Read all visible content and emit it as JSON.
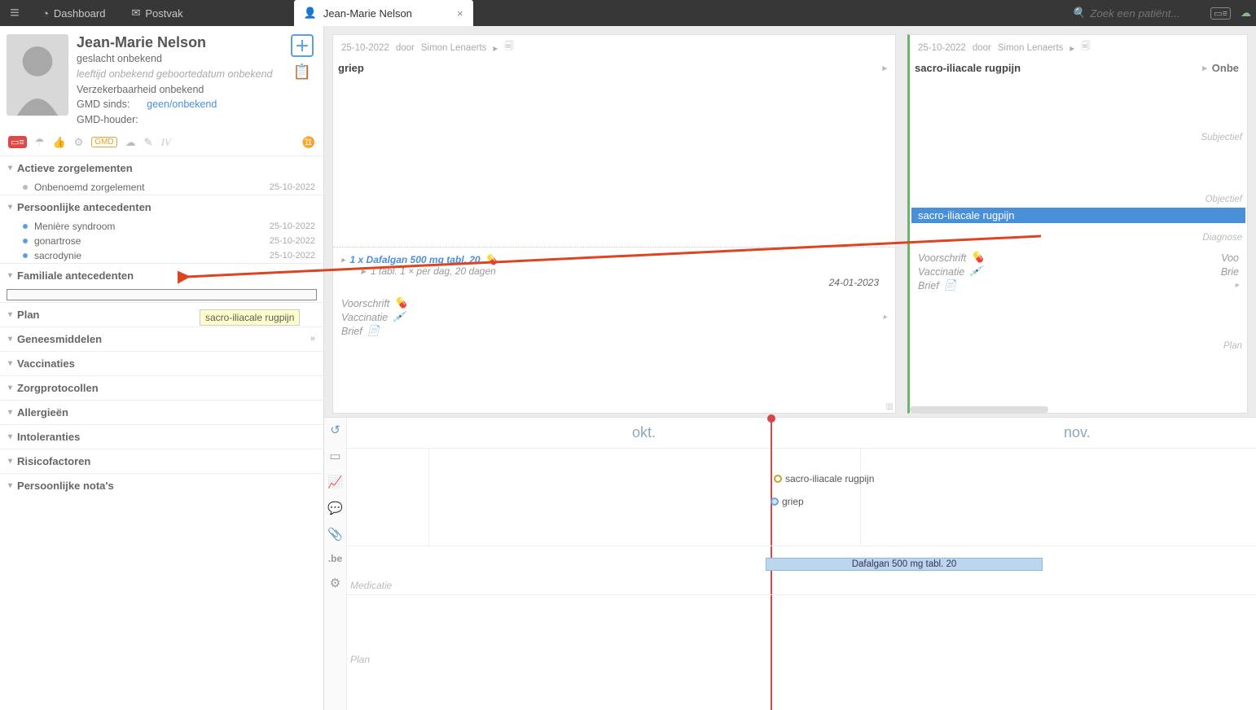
{
  "topbar": {
    "dashboard": "Dashboard",
    "postvak": "Postvak",
    "tab_label": "Jean-Marie Nelson",
    "search_placeholder": "Zoek een patiënt..."
  },
  "patient": {
    "name": "Jean-Marie Nelson",
    "gender": "geslacht onbekend",
    "age_birth": "leeftijd onbekend geboortedatum onbekend",
    "insurability": "Verzekerbaarheid onbekend",
    "gmd_since_label": "GMD sinds:",
    "gmd_since_value": "geen/onbekend",
    "gmd_holder_label": "GMD-houder:"
  },
  "iconrow": {
    "gmd_badge": "GMD",
    "iv": "IV"
  },
  "sections": {
    "actieve": {
      "title": "Actieve zorgelementen",
      "items": [
        {
          "label": "Onbenoemd zorgelement",
          "date": "25-10-2022",
          "dot": "grey"
        }
      ]
    },
    "persoonlijke": {
      "title": "Persoonlijke antecedenten",
      "items": [
        {
          "label": "Menière syndroom",
          "date": "25-10-2022",
          "dot": "blue"
        },
        {
          "label": "gonartrose",
          "date": "25-10-2022",
          "dot": "blue"
        },
        {
          "label": "sacrodynie",
          "date": "25-10-2022",
          "dot": "blue"
        }
      ]
    },
    "familiale": {
      "title": "Familiale antecedenten"
    },
    "plan": {
      "title": "Plan"
    },
    "geneesmiddelen": {
      "title": "Geneesmiddelen"
    },
    "vaccinaties": {
      "title": "Vaccinaties"
    },
    "zorgprotocollen": {
      "title": "Zorgprotocollen"
    },
    "allergieen": {
      "title": "Allergieën"
    },
    "intoleranties": {
      "title": "Intoleranties"
    },
    "risicofactoren": {
      "title": "Risicofactoren"
    },
    "notas": {
      "title": "Persoonlijke nota's"
    }
  },
  "drag_tooltip": "sacro-iliacale rugpijn",
  "contact_left": {
    "date": "25-10-2022",
    "by_label": "door",
    "author": "Simon Lenaerts",
    "title": "griep",
    "med": {
      "title": "1 x Dafalgan 500 mg tabl. 20",
      "posology": "1 tabl.   1 × per dag,   20 dagen",
      "end": "24-01-2023"
    },
    "voorschrift": "Voorschrift",
    "vaccinatie": "Vaccinatie",
    "brief": "Brief"
  },
  "contact_right": {
    "date": "25-10-2022",
    "by_label": "door",
    "author": "Simon Lenaerts",
    "title": "sacro-iliacale rugpijn",
    "onb_label": "Onbe",
    "subjectief": "Subjectief",
    "objectief": "Objectief",
    "diagnose": "Diagnose",
    "diag_value": "sacro-iliacale rugpijn",
    "voorschrift": "Voorschrift",
    "vaccinatie": "Vaccinatie",
    "brief": "Brief",
    "plan_label": "Plan",
    "voor": "Voo",
    "brie": "Brie"
  },
  "timeline": {
    "months": {
      "okt": "okt.",
      "nov": "nov."
    },
    "events": [
      {
        "label": "sacro-iliacale rugpijn",
        "color": "#c8a030"
      },
      {
        "label": "griep",
        "color": "#6aa8d8"
      }
    ],
    "med_label": "Medicatie",
    "med_bar": "Dafalgan 500 mg tabl. 20",
    "plan_label": "Plan",
    "be": ".be"
  }
}
